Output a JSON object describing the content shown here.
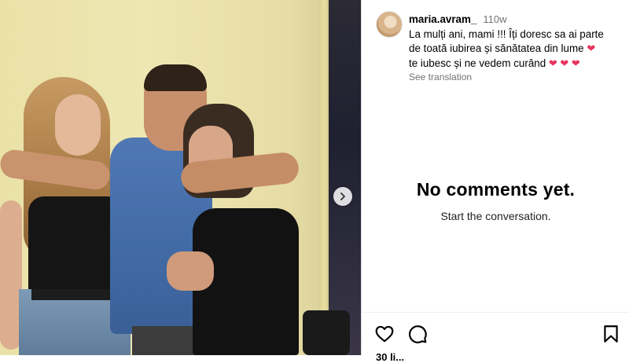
{
  "post": {
    "carousel_next_icon": "chevron-right-icon"
  },
  "caption": {
    "username": "maria.avram_",
    "time_ago": "110w",
    "line1": "La mulți ani, mami !!! Îți doresc sa ai parte",
    "line2": "de toată iubirea și sănătatea din lume",
    "line3": "te iubesc și ne vedem curând",
    "heart_single": "❤",
    "hearts_triple": "❤ ❤ ❤",
    "see_translation": "See translation"
  },
  "comments": {
    "empty_title": "No comments yet.",
    "empty_subtitle": "Start the conversation."
  },
  "actions": {
    "like_icon": "heart-outline-icon",
    "comment_icon": "comment-icon",
    "save_icon": "bookmark-icon",
    "likes_text": "30 li..."
  },
  "colors": {
    "heart": "#e8345e",
    "muted_text": "#737373",
    "border": "#dbdbdb"
  }
}
